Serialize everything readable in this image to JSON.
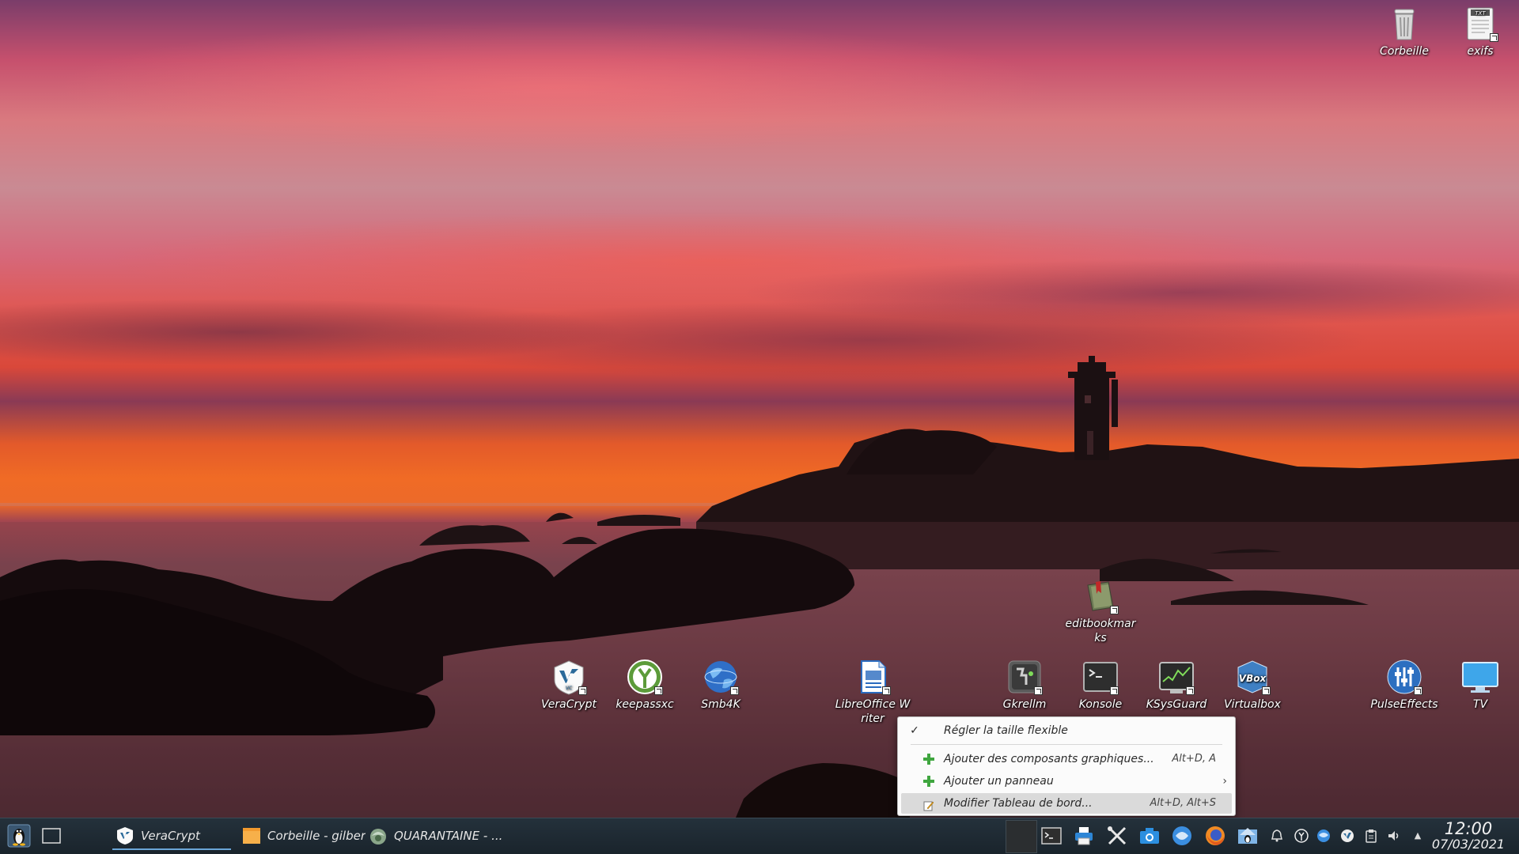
{
  "desktop": {
    "top_icons": [
      {
        "label": "Corbeille",
        "icon": "trash-icon"
      },
      {
        "label": "exifs",
        "icon": "text-file-icon",
        "badge": "TXT"
      }
    ],
    "bottom_icons": [
      {
        "label": "VeraCrypt",
        "icon": "veracrypt-icon"
      },
      {
        "label": "keepassxc",
        "icon": "keepassxc-icon"
      },
      {
        "label": "Smb4K",
        "icon": "network-globe-icon"
      },
      {
        "label": "LibreOffice Writer",
        "icon": "writer-document-icon"
      },
      {
        "label": "Gkrellm",
        "icon": "gkrellm-icon"
      },
      {
        "label": "Konsole",
        "icon": "terminal-icon"
      },
      {
        "label": "KSysGuard",
        "icon": "system-monitor-icon"
      },
      {
        "label": "Virtualbox",
        "icon": "virtualbox-icon",
        "badge": "VBox"
      },
      {
        "label": "PulseEffects",
        "icon": "pulseeffects-icon"
      },
      {
        "label": "TV",
        "icon": "monitor-icon"
      }
    ],
    "extra_icons": [
      {
        "label": "editbookmarks",
        "icon": "bookmarks-book-icon"
      }
    ]
  },
  "context_menu": {
    "items": [
      {
        "label": "Régler la taille flexible",
        "checked": true,
        "shortcut": ""
      },
      {
        "label": "Ajouter des composants graphiques...",
        "shortcut": "Alt+D, A"
      },
      {
        "label": "Ajouter un panneau",
        "shortcut": "",
        "submenu": true,
        "arrow": "›"
      },
      {
        "label": "Modifier Tableau de bord...",
        "shortcut": "Alt+D, Alt+S",
        "highlighted": true
      }
    ],
    "check_glyph": "✓"
  },
  "taskbar": {
    "tasks": [
      {
        "label": "VeraCrypt",
        "icon": "veracrypt-icon",
        "active": true
      },
      {
        "label": "Corbeille - gilbert",
        "icon": "folder-icon"
      },
      {
        "label": "QUARANTAINE - ...",
        "icon": "clamtk-icon"
      }
    ],
    "tray": [
      "pager",
      "konsole",
      "printer",
      "tools",
      "camera",
      "network",
      "firefox",
      "home-folder",
      "notifications",
      "keepassxc",
      "network-globe",
      "veracrypt",
      "clipboard",
      "volume",
      "expand"
    ],
    "expand_glyph": "▲",
    "clock": {
      "time": "12:00",
      "date": "07/03/2021"
    }
  }
}
